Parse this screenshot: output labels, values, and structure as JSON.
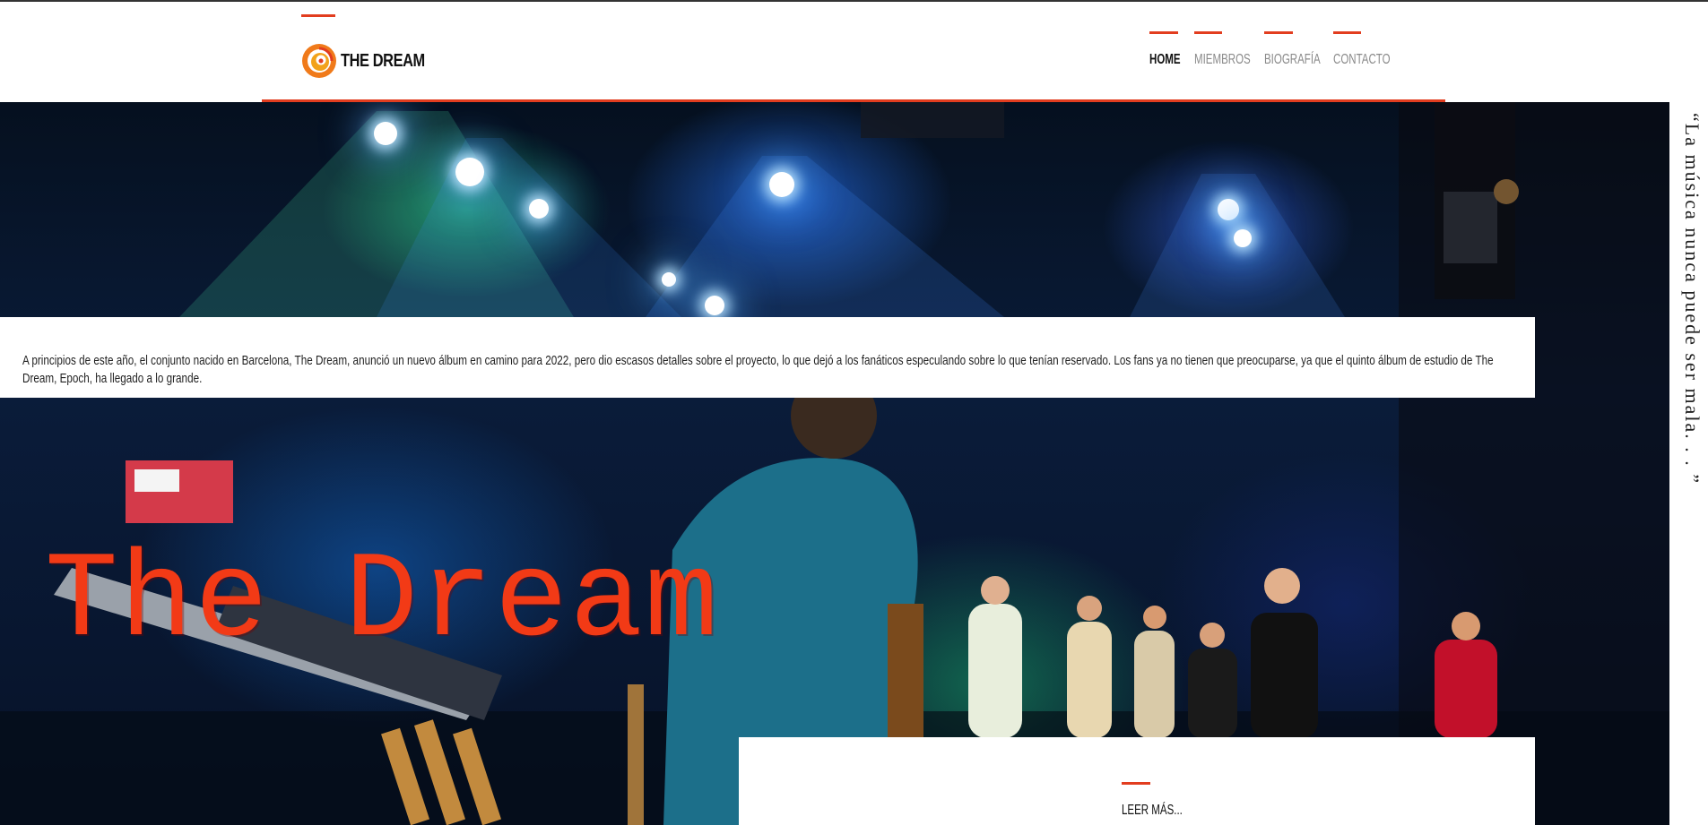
{
  "brand": {
    "name": "THE DREAM",
    "accent": "#e23d1f"
  },
  "nav": [
    {
      "label": "HOME",
      "active": true
    },
    {
      "label": "MIEMBROS",
      "active": false
    },
    {
      "label": "BIOGRAFÍA",
      "active": false
    },
    {
      "label": "CONTACTO",
      "active": false
    }
  ],
  "intro": {
    "text": "A principios de este año, el conjunto nacido en Barcelona, The Dream, anunció un nuevo álbum en camino para 2022, pero dio escasos detalles sobre el proyecto, lo que dejó a los fanáticos especulando sobre lo que tenían reservado. Los fans ya no tienen que preocuparse, ya que el quinto álbum de estudio de The Dream, Epoch, ha llegado a lo grande."
  },
  "hero": {
    "title": "The Dream",
    "image_alt": "concert-stage-photo"
  },
  "quote": {
    "text": "“La música nunca puede ser mala. . . ”"
  },
  "readmore": {
    "label": "LEER MÁS..."
  }
}
